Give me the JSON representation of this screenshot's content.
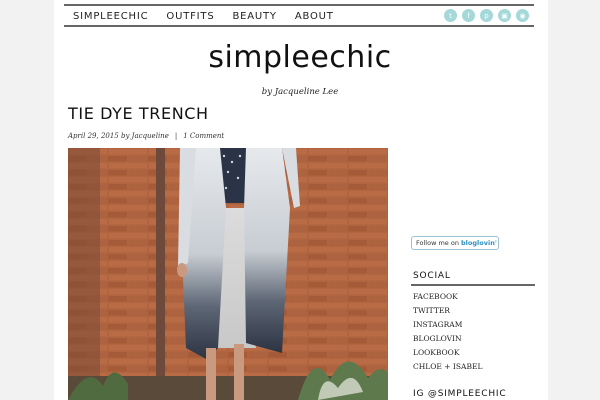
{
  "nav": {
    "items": [
      "SIMPLEECHIC",
      "OUTFITS",
      "BEAUTY",
      "ABOUT"
    ]
  },
  "social_icons": [
    "twitter-icon",
    "facebook-icon",
    "pinterest-icon",
    "instagram-icon",
    "rss-icon"
  ],
  "header": {
    "site_title": "simpleechic",
    "byline": "by Jacqueline Lee"
  },
  "post": {
    "title": "TIE DYE TRENCH",
    "date": "April 29, 2015",
    "author_prefix": "by",
    "author": "Jacqueline",
    "separator": "|",
    "comments": "1 Comment"
  },
  "sidebar": {
    "bloglovin": {
      "prefix": "Follow me on",
      "brand": "bloglovin'"
    },
    "social_title": "SOCIAL",
    "social_links": [
      "FACEBOOK",
      "TWITTER",
      "INSTAGRAM",
      "BLOGLOVIN",
      "LOOKBOOK",
      "CHLOE + ISABEL"
    ],
    "ig_title": "IG @SIMPLEECHIC"
  },
  "colors": {
    "accent_social": "#a5d8d8",
    "rule": "#666666",
    "brick": "#a55a3c"
  }
}
